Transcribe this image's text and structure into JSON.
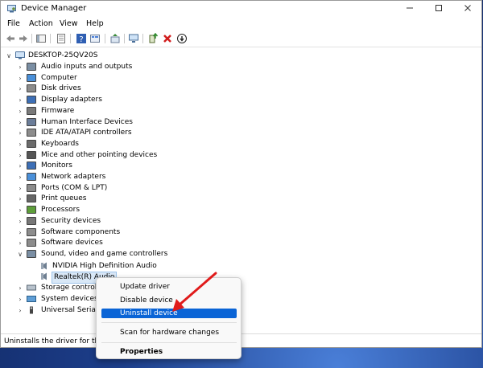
{
  "window": {
    "title": "Device Manager"
  },
  "menu": [
    "File",
    "Action",
    "View",
    "Help"
  ],
  "tree": {
    "root": "DESKTOP-25QV20S",
    "categories": [
      "Audio inputs and outputs",
      "Computer",
      "Disk drives",
      "Display adapters",
      "Firmware",
      "Human Interface Devices",
      "IDE ATA/ATAPI controllers",
      "Keyboards",
      "Mice and other pointing devices",
      "Monitors",
      "Network adapters",
      "Ports (COM & LPT)",
      "Print queues",
      "Processors",
      "Security devices",
      "Software components",
      "Software devices",
      "Sound, video and game controllers"
    ],
    "sound_children": [
      "NVIDIA High Definition Audio",
      "Realtek(R) Audio"
    ],
    "after": [
      "Storage controlle",
      "System devices",
      "Universal Serial B"
    ]
  },
  "status": "Uninstalls the driver for the s",
  "context_menu": {
    "items": [
      "Update driver",
      "Disable device",
      "Uninstall device",
      "Scan for hardware changes",
      "Properties"
    ],
    "highlighted": "Uninstall device"
  },
  "colors": {
    "highlight": "#0a64d6",
    "annotation_arrow": "#e01b1b"
  }
}
